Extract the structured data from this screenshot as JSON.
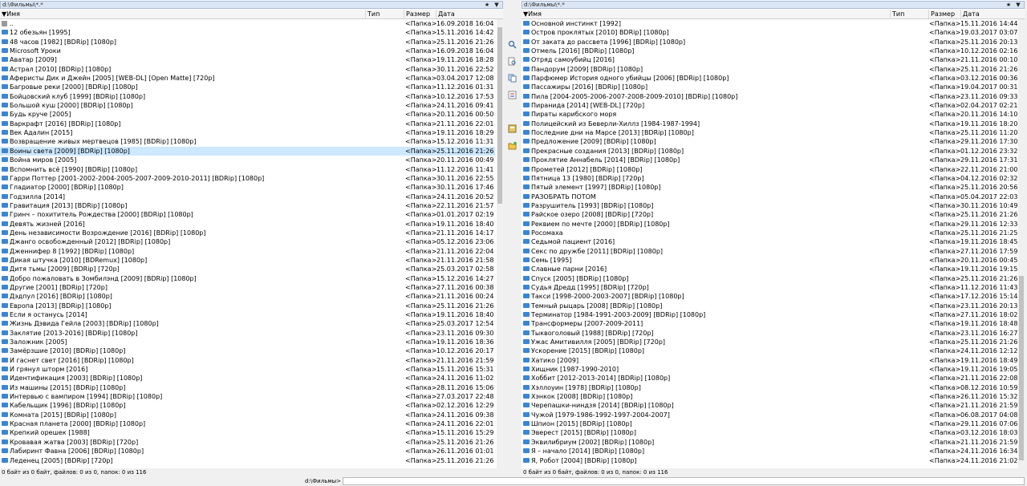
{
  "left": {
    "path": "d:\\Фильмы\\*.*",
    "columns": {
      "name": "Имя",
      "type": "Тип",
      "size": "Размер",
      "date": "Дата"
    },
    "status": "0 байт из 0 байт, файлов: 0 из 0, папок: 0 из 116",
    "selected_index": 14,
    "files": [
      {
        "name": "..",
        "size": "<Папка>",
        "date": "16.09.2018 16:04",
        "up": true
      },
      {
        "name": "12 обезьян [1995]",
        "size": "<Папка>",
        "date": "15.11.2016 14:42"
      },
      {
        "name": "48 часов [1982] [BDRip] [1080p]",
        "size": "<Папка>",
        "date": "25.11.2016 21:26"
      },
      {
        "name": "Microsoft Уроки",
        "size": "<Папка>",
        "date": "16.09.2018 16:04"
      },
      {
        "name": "Аватар [2009]",
        "size": "<Папка>",
        "date": "19.11.2016 18:28"
      },
      {
        "name": "Астрал [2010] [BDRip] [1080p]",
        "size": "<Папка>",
        "date": "30.11.2016 22:52"
      },
      {
        "name": "Аферисты Дик и Джейн [2005] [WEB-DL] [Open Matte] [720p]",
        "size": "<Папка>",
        "date": "03.04.2017 12:08"
      },
      {
        "name": "Багровые реки [2000] [BDRip] [1080p]",
        "size": "<Папка>",
        "date": "11.12.2016 01:31"
      },
      {
        "name": "Бойцовский клуб [1999] [BDRip] [1080p]",
        "size": "<Папка>",
        "date": "10.12.2016 17:53"
      },
      {
        "name": "Большой куш [2000] [BDRip] [1080p]",
        "size": "<Папка>",
        "date": "24.11.2016 09:41"
      },
      {
        "name": "Будь круче [2005]",
        "size": "<Папка>",
        "date": "20.11.2016 00:50"
      },
      {
        "name": "Варкрафт [2016] [BDRip] [1080p]",
        "size": "<Папка>",
        "date": "21.11.2016 22:01"
      },
      {
        "name": "Век Адалин [2015]",
        "size": "<Папка>",
        "date": "19.11.2016 18:29"
      },
      {
        "name": "Возвращение живых мертвецов [1985] [BDRip] [1080p]",
        "size": "<Папка>",
        "date": "15.12.2016 11:31"
      },
      {
        "name": "Воины света [2009] [BDRip] [1080p]",
        "size": "<Папка>",
        "date": "25.11.2016 21:26"
      },
      {
        "name": "Война миров [2005]",
        "size": "<Папка>",
        "date": "20.11.2016 00:49"
      },
      {
        "name": "Вспомнить всё [1990] [BDRip] [1080p]",
        "size": "<Папка>",
        "date": "11.12.2016 11:41"
      },
      {
        "name": "Гарри Поттер [2001-2002-2004-2005-2007-2009-2010-2011] [BDRip] [1080p]",
        "size": "<Папка>",
        "date": "30.11.2016 22:55"
      },
      {
        "name": "Гладиатор [2000] [BDRip] [1080p]",
        "size": "<Папка>",
        "date": "30.11.2016 17:46"
      },
      {
        "name": "Годзилла [2014]",
        "size": "<Папка>",
        "date": "24.11.2016 20:52"
      },
      {
        "name": "Гравитация [2013] [BDRip] [1080p]",
        "size": "<Папка>",
        "date": "22.11.2016 21:57"
      },
      {
        "name": "Гринч – похититель Рождества [2000] [BDRip] [1080p]",
        "size": "<Папка>",
        "date": "01.01.2017 02:19"
      },
      {
        "name": "Девять жизней [2016]",
        "size": "<Папка>",
        "date": "19.11.2016 18:40"
      },
      {
        "name": "День независимости Возрождение [2016] [BDRip] [1080p]",
        "size": "<Папка>",
        "date": "21.11.2016 14:17"
      },
      {
        "name": "Джанго освобожденный [2012] [BDRip] [1080p]",
        "size": "<Папка>",
        "date": "05.12.2016 23:06"
      },
      {
        "name": "Дженнифер 8 [1992] [BDRip] [1080p]",
        "size": "<Папка>",
        "date": "21.11.2016 22:04"
      },
      {
        "name": "Дикая штучка [2010] [BDRemux] [1080p]",
        "size": "<Папка>",
        "date": "21.11.2016 21:58"
      },
      {
        "name": "Дитя тьмы [2009] [BDRip] [720p]",
        "size": "<Папка>",
        "date": "25.03.2017 02:58"
      },
      {
        "name": "Добро пожаловать в Зомбилэнд [2009] [BDRip] [1080p]",
        "size": "<Папка>",
        "date": "15.12.2016 14:27"
      },
      {
        "name": "Другие [2001] [BDRip] [720p]",
        "size": "<Папка>",
        "date": "27.11.2016 00:38"
      },
      {
        "name": "Дэдпул [2016] [BDRip] [1080p]",
        "size": "<Папка>",
        "date": "21.11.2016 00:24"
      },
      {
        "name": "Европа [2013] [BDRip] [1080p]",
        "size": "<Папка>",
        "date": "25.11.2016 21:26"
      },
      {
        "name": "Если я останусь [2014]",
        "size": "<Папка>",
        "date": "19.11.2016 18:40"
      },
      {
        "name": "Жизнь Дэвида Гейла [2003] [BDRip] [1080p]",
        "size": "<Папка>",
        "date": "25.03.2017 12:54"
      },
      {
        "name": "Заклятие [2013-2016] [BDRip] [1080p]",
        "size": "<Папка>",
        "date": "23.11.2016 09:30"
      },
      {
        "name": "Заложник [2005]",
        "size": "<Папка>",
        "date": "19.11.2016 18:36"
      },
      {
        "name": "Замёрзшие [2010] [BDRip] [1080p]",
        "size": "<Папка>",
        "date": "10.12.2016 20:17"
      },
      {
        "name": "И гаснет свет [2016] [BDRip] [1080p]",
        "size": "<Папка>",
        "date": "21.11.2016 21:59"
      },
      {
        "name": "И грянул шторм [2016]",
        "size": "<Папка>",
        "date": "15.11.2016 15:31"
      },
      {
        "name": "Идентификация [2003] [BDRip] [1080p]",
        "size": "<Папка>",
        "date": "24.11.2016 11:02"
      },
      {
        "name": "Из машины [2015] [BDRip] [1080p]",
        "size": "<Папка>",
        "date": "28.11.2016 15:06"
      },
      {
        "name": "Интервью с вампиром [1994] [BDRip] [1080p]",
        "size": "<Папка>",
        "date": "27.03.2017 22:48"
      },
      {
        "name": "Кабельщик [1996] [BDRip] [1080p]",
        "size": "<Папка>",
        "date": "02.12.2016 12:29"
      },
      {
        "name": "Комната [2015] [BDRip] [1080p]",
        "size": "<Папка>",
        "date": "24.11.2016 09:38"
      },
      {
        "name": "Красная планета [2000] [BDRip] [1080p]",
        "size": "<Папка>",
        "date": "24.11.2016 22:01"
      },
      {
        "name": "Крепкий орешек [1988]",
        "size": "<Папка>",
        "date": "15.11.2016 15:29"
      },
      {
        "name": "Кровавая жатва [2003] [BDRip] [720p]",
        "size": "<Папка>",
        "date": "25.11.2016 21:26"
      },
      {
        "name": "Лабиринт Фавна [2006] [BDRip] [1080p]",
        "size": "<Папка>",
        "date": "26.11.2016 01:01"
      },
      {
        "name": "Леденец [2005] [BDRip] [720p]",
        "size": "<Папка>",
        "date": "25.11.2016 21:26"
      }
    ]
  },
  "right": {
    "path": "d:\\Фильмы\\*.*",
    "columns": {
      "name": "Имя",
      "type": "Тип",
      "size": "Размер",
      "date": "Дата"
    },
    "status": "0 байт из 0 байт, файлов: 0 из 0, папок: 0 из 116",
    "files": [
      {
        "name": "Основной инстинкт [1992]",
        "size": "<Папка>",
        "date": "15.11.2016 14:44"
      },
      {
        "name": "Остров проклятых [2010] BDRip] [1080p]",
        "size": "<Папка>",
        "date": "19.03.2017 03:07"
      },
      {
        "name": "От заката до рассвета [1996] [BDRip] [1080p]",
        "size": "<Папка>",
        "date": "25.11.2016 20:13"
      },
      {
        "name": "Отмель [2016] [BDRip] [1080p]",
        "size": "<Папка>",
        "date": "10.12.2016 02:16"
      },
      {
        "name": "Отряд самоубийц [2016]",
        "size": "<Папка>",
        "date": "21.11.2016 00:10"
      },
      {
        "name": "Пандорум [2009] [BDRip] [1080p]",
        "size": "<Папка>",
        "date": "25.11.2016 21:26"
      },
      {
        "name": "Парфюмер История одного убийцы [2006] [BDRip] [1080p]",
        "size": "<Папка>",
        "date": "03.12.2016 00:36"
      },
      {
        "name": "Пассажиры [2016] [BDRip] [1080p]",
        "size": "<Папка>",
        "date": "19.04.2017 00:31"
      },
      {
        "name": "Пила [2004-2005-2006-2007-2008-2009-2010] [BDRip] [1080p]",
        "size": "<Папка>",
        "date": "23.11.2016 09:33"
      },
      {
        "name": "Пиранида [2014] [WEB-DL] [720p]",
        "size": "<Папка>",
        "date": "02.04.2017 02:21"
      },
      {
        "name": "Пираты карибского моря",
        "size": "<Папка>",
        "date": "20.11.2016 14:10"
      },
      {
        "name": "Полицейский из Беверли-Хиллз [1984-1987-1994]",
        "size": "<Папка>",
        "date": "19.11.2016 18:20"
      },
      {
        "name": "Последние дни на Марсе [2013] [BDRip] [1080p]",
        "size": "<Папка>",
        "date": "25.11.2016 11:20"
      },
      {
        "name": "Предложение [2009] [BDRip] [1080p]",
        "size": "<Папка>",
        "date": "29.11.2016 17:30"
      },
      {
        "name": "Прекрасные создания [2013] [BDRip] [1080p]",
        "size": "<Папка>",
        "date": "01.12.2016 23:32"
      },
      {
        "name": "Проклятие Аннабель [2014] [BDRip] [1080p]",
        "size": "<Папка>",
        "date": "29.11.2016 17:31"
      },
      {
        "name": "Прометей [2012] [BDRip] [1080p]",
        "size": "<Папка>",
        "date": "22.11.2016 21:00"
      },
      {
        "name": "Пятница 13 [1980] [BDRip] [720p]",
        "size": "<Папка>",
        "date": "04.12.2016 02:32"
      },
      {
        "name": "Пятый элемент [1997] [BDRip] [1080p]",
        "size": "<Папка>",
        "date": "25.11.2016 20:56"
      },
      {
        "name": "РАЗОБРАТЬ ПОТОМ",
        "size": "<Папка>",
        "date": "05.04.2017 22:03"
      },
      {
        "name": "Разрушитель [1993] [BDRip] [1080p]",
        "size": "<Папка>",
        "date": "30.11.2016 10:49"
      },
      {
        "name": "Райское озеро [2008] [BDRip] [720p]",
        "size": "<Папка>",
        "date": "25.11.2016 21:26"
      },
      {
        "name": "Реквием по мечте [2000] [BDRip] [1080p]",
        "size": "<Папка>",
        "date": "29.11.2016 12:33"
      },
      {
        "name": "Росомаха",
        "size": "<Папка>",
        "date": "25.11.2016 21:25"
      },
      {
        "name": "Седьмой пациент [2016]",
        "size": "<Папка>",
        "date": "19.11.2016 18:45"
      },
      {
        "name": "Секс по дружбе [2011] [BDRip] [1080p]",
        "size": "<Папка>",
        "date": "27.11.2016 17:59"
      },
      {
        "name": "Семь [1995]",
        "size": "<Папка>",
        "date": "20.11.2016 00:45"
      },
      {
        "name": "Славные парни [2016]",
        "size": "<Папка>",
        "date": "19.11.2016 19:15"
      },
      {
        "name": "Спуск [2005] [BDRip] [1080p]",
        "size": "<Папка>",
        "date": "25.11.2016 21:26"
      },
      {
        "name": "Судья Дредд [1995] [BDRip] [720p]",
        "size": "<Папка>",
        "date": "11.12.2016 11:43"
      },
      {
        "name": "Такси [1998-2000-2003-2007] [BDRip] [1080p]",
        "size": "<Папка>",
        "date": "17.12.2016 15:14"
      },
      {
        "name": "Темный рыцарь [2008] [BDRip] [1080p]",
        "size": "<Папка>",
        "date": "23.11.2016 20:13"
      },
      {
        "name": "Терминатор [1984-1991-2003-2009] [BDRip] [1080p]",
        "size": "<Папка>",
        "date": "27.11.2016 18:02"
      },
      {
        "name": "Трансформеры [2007-2009-2011]",
        "size": "<Папка>",
        "date": "19.11.2016 18:48"
      },
      {
        "name": "Тыквоголовый [1988] [BDRip] [720p]",
        "size": "<Папка>",
        "date": "23.11.2016 16:27"
      },
      {
        "name": "Ужас Амитивилля [2005] [BDRip] [720p]",
        "size": "<Папка>",
        "date": "25.11.2016 21:26"
      },
      {
        "name": "Ускорение [2015] [BDRip] [1080p]",
        "size": "<Папка>",
        "date": "24.11.2016 12:12"
      },
      {
        "name": "Хатико [2009]",
        "size": "<Папка>",
        "date": "19.11.2016 18:49"
      },
      {
        "name": "Хищник [1987-1990-2010]",
        "size": "<Папка>",
        "date": "19.11.2016 19:05"
      },
      {
        "name": "Хоббит [2012-2013-2014] [BDRip] [1080p]",
        "size": "<Папка>",
        "date": "21.11.2016 22:08"
      },
      {
        "name": "Хэллоуин [1978] [BDRip] [1080p]",
        "size": "<Папка>",
        "date": "08.12.2016 10:59"
      },
      {
        "name": "Хэнкок [2008] [BDRip] [1080p]",
        "size": "<Папка>",
        "date": "26.11.2016 15:32"
      },
      {
        "name": "Черепашки-ниндзя [2014] [BDRip] [1080p]",
        "size": "<Папка>",
        "date": "21.11.2016 21:59"
      },
      {
        "name": "Чужой [1979-1986-1992-1997-2004-2007]",
        "size": "<Папка>",
        "date": "06.08.2017 04:08"
      },
      {
        "name": "Шпион [2015] [BDRip] [1080p]",
        "size": "<Папка>",
        "date": "29.11.2016 07:06"
      },
      {
        "name": "Эверест [2015] [BDRip] [1080p]",
        "size": "<Папка>",
        "date": "03.12.2016 18:03"
      },
      {
        "name": "Эквилибриум [2002] [BDRip] [1080p]",
        "size": "<Папка>",
        "date": "21.11.2016 21:59"
      },
      {
        "name": "Я – начало [2014] [BDRip] [1080p]",
        "size": "<Папка>",
        "date": "24.11.2016 16:34"
      },
      {
        "name": "Я, Робот [2004] [BDRip] [1080p]",
        "size": "<Папка>",
        "date": "24.11.2016 21:02"
      }
    ]
  },
  "command_line": {
    "label": "d:\\Фильмы>",
    "value": ""
  },
  "toolbar_icons": [
    "search-icon",
    "find-files-icon",
    "copy-names-icon",
    "compare-icon",
    "calculator-icon",
    "new-folder-icon"
  ],
  "colors": {
    "folder": "#3a86d4",
    "selection": "#cde8ff",
    "path_bar": "#dbe6f4"
  }
}
